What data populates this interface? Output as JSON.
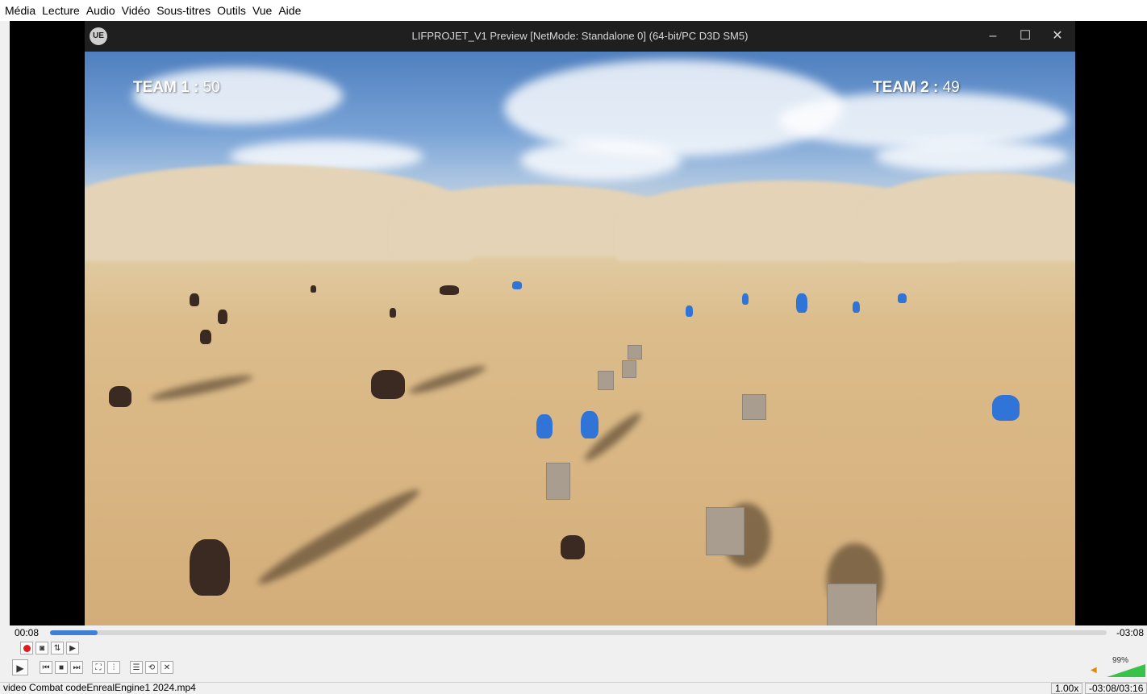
{
  "menubar": {
    "items": [
      "Média",
      "Lecture",
      "Audio",
      "Vidéo",
      "Sous-titres",
      "Outils",
      "Vue",
      "Aide"
    ]
  },
  "ue_window": {
    "title": "LIFPROJET_V1 Preview [NetMode: Standalone 0]  (64-bit/PC D3D SM5)",
    "logo": "UE",
    "minimize_glyph": "–",
    "maximize_glyph": "☐",
    "close_glyph": "✕"
  },
  "hud": {
    "team1_label": "TEAM 1 :",
    "team1_score": "50",
    "team2_label": "TEAM 2 :",
    "team2_score": "49"
  },
  "player": {
    "elapsed": "00:08",
    "remaining": "-03:08",
    "progress_fraction": 0.045,
    "speed": "1.00x",
    "time_display": "-03:08/03:16",
    "volume": "99%",
    "file_name": "video Combat codeEnrealEngine1 2024.mp4"
  },
  "icons": {
    "record": "record-icon",
    "snapshot": "camera-icon",
    "loop_ab": "loop-ab-icon",
    "frame_step": "frame-step-icon",
    "play": "play-icon",
    "previous": "previous-icon",
    "stop": "stop-icon",
    "next": "next-icon",
    "fullscreen": "fullscreen-icon",
    "extended": "equalizer-icon",
    "playlist": "playlist-icon",
    "loop": "loop-icon",
    "shuffle": "shuffle-icon",
    "speaker": "speaker-icon"
  },
  "colors": {
    "accent": "#3f7fd6",
    "record": "#e01b1b",
    "volume": "#38c24a",
    "team_blue": "#2f74d6",
    "team_red": "#3a2a22"
  }
}
